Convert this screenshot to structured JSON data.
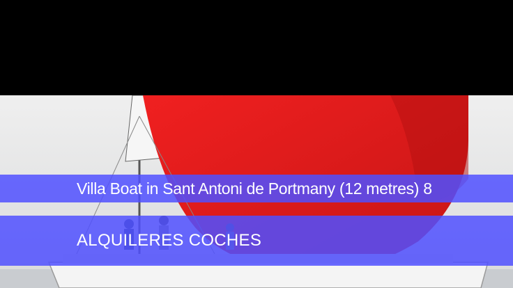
{
  "hero": {
    "image_name": "sailboat-red-spinnaker-photo",
    "colors": {
      "sail_red": "#e81f1f",
      "sky": "#e6e7e6",
      "band": "#5050ff"
    }
  },
  "banner": {
    "title": "Villa Boat in Sant Antoni de Portmany (12 metres) 8",
    "subtitle": "ALQUILERES COCHES"
  }
}
